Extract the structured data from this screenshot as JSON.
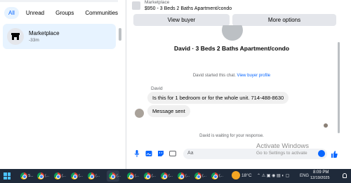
{
  "sidebar": {
    "filters": [
      "All",
      "Unread",
      "Groups",
      "Communities"
    ],
    "active_filter": "All",
    "conversation": {
      "title": "Marketplace",
      "time": "-33m"
    }
  },
  "listing": {
    "category": "Marketplace",
    "title": "$950 - 3 Beds 2 Baths Apartment/condo"
  },
  "actions": {
    "view_buyer": "View buyer",
    "more_options": "More options"
  },
  "chat": {
    "title": "David · 3 Beds 2 Baths Apartment/condo",
    "system_start": "David started this chat.",
    "system_start_link": "View buyer profile",
    "sender_name": "David",
    "messages": [
      "Is this for 1 bedroom or for the whole unit. 714-488-8630",
      "Message sent"
    ],
    "system_wait": "David is waiting for your response."
  },
  "composer": {
    "placeholder": "Aa"
  },
  "watermark": {
    "title": "Activate Windows",
    "subtitle": "Go to Settings to activate"
  },
  "taskbar": {
    "temperature": "18°C",
    "language": "ENG",
    "time": "8:09 PM",
    "date": "12/19/2025",
    "apps": [
      "S...",
      "(...",
      "(...",
      "(...",
      "(...",
      "(...",
      "(...",
      "(...",
      "(...",
      "(...",
      "(...",
      "(..."
    ],
    "colors": {
      "bar": "#1f2a3a",
      "accent": "#0866ff"
    }
  }
}
